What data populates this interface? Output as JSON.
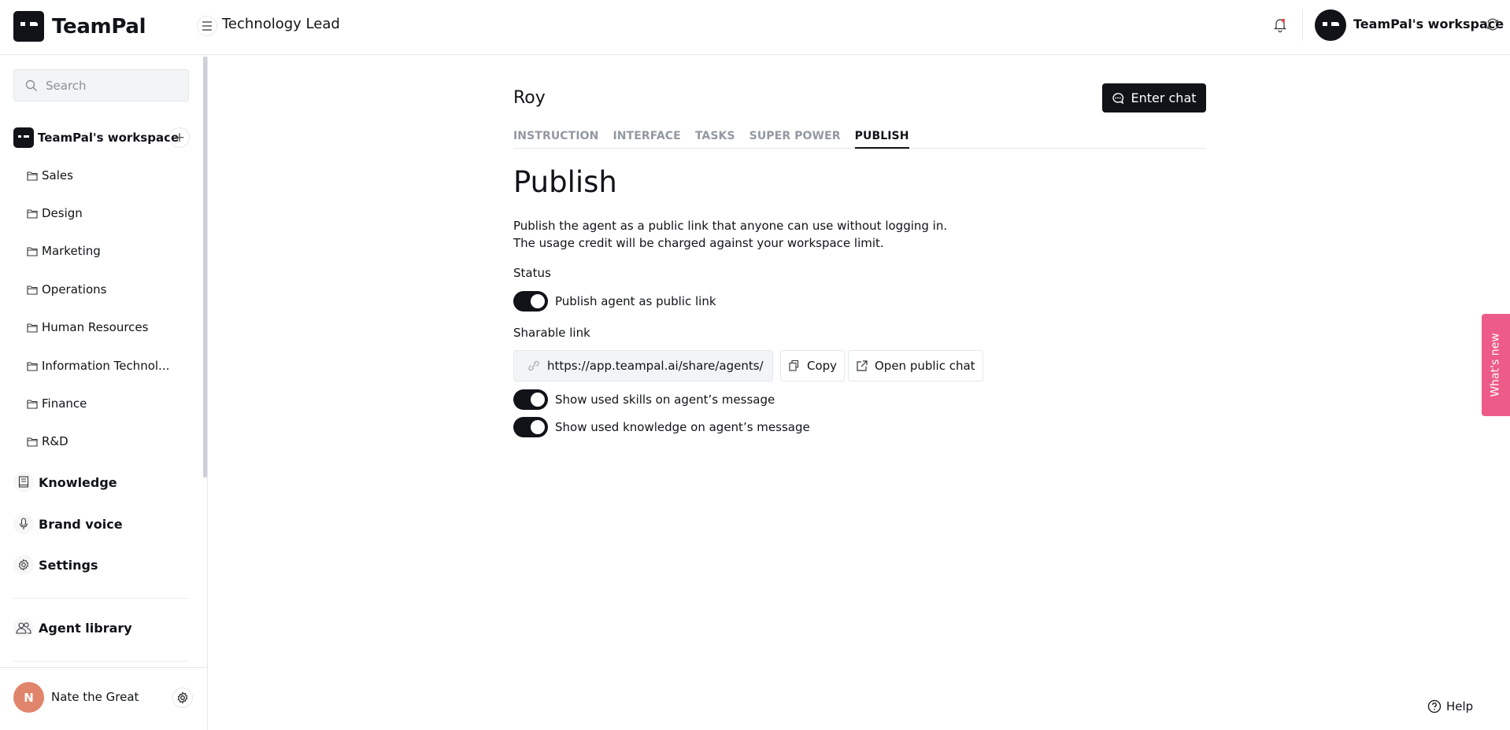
{
  "app": {
    "brand": "TeamPal",
    "page_title": "Technology Lead",
    "workspace_name": "TeamPal's workspace",
    "accent_color": "#111318",
    "whats_new_color": "#ed5b88"
  },
  "sidebar": {
    "search_placeholder": "Search",
    "workspace_label": "TeamPal's workspace",
    "folders": [
      "Sales",
      "Design",
      "Marketing",
      "Operations",
      "Human Resources",
      "Information Technol...",
      "Finance",
      "R&D"
    ],
    "nav": {
      "knowledge": "Knowledge",
      "brand_voice": "Brand voice",
      "settings": "Settings",
      "agent_library": "Agent library"
    },
    "user": {
      "initial": "N",
      "name": "Nate the Great"
    }
  },
  "main": {
    "agent_name": "Roy",
    "enter_chat_label": "Enter chat",
    "tabs": [
      "INSTRUCTION",
      "INTERFACE",
      "TASKS",
      "SUPER POWER",
      "PUBLISH"
    ],
    "active_tab": "PUBLISH",
    "heading": "Publish",
    "description_line1": "Publish the agent as a public link that anyone can use without logging in.",
    "description_line2": "The usage credit will be charged against your workspace limit.",
    "status_label": "Status",
    "publish_toggle_label": "Publish agent as public link",
    "publish_toggle_on": true,
    "sharable_link_label": "Sharable link",
    "sharable_link_value": "https://app.teampal.ai/share/agents/",
    "copy_label": "Copy",
    "open_public_chat_label": "Open public chat",
    "show_skills_label": "Show used skills on agent’s message",
    "show_skills_on": true,
    "show_knowledge_label": "Show used knowledge on agent’s message",
    "show_knowledge_on": true
  },
  "widgets": {
    "whats_new": "What's new",
    "help": "Help"
  }
}
